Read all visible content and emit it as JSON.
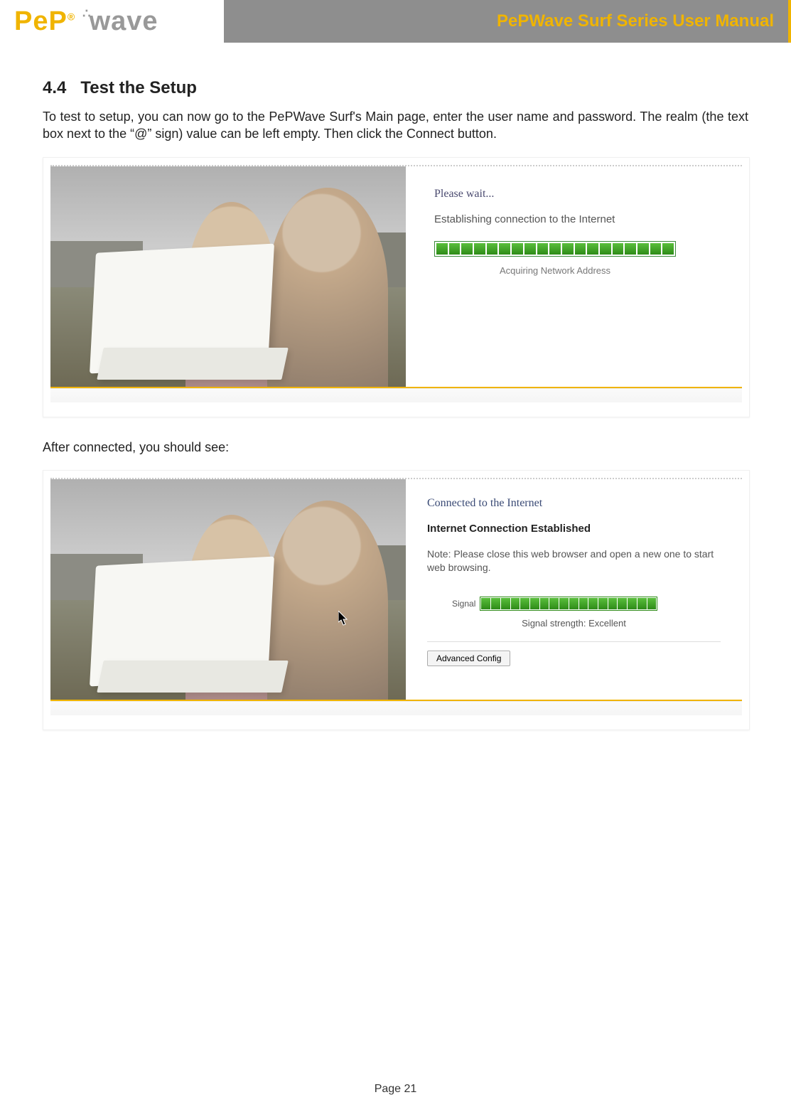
{
  "header": {
    "logo_left": "PeP",
    "logo_right": "wave",
    "title": "PePWave Surf Series User Manual"
  },
  "section": {
    "number": "4.4",
    "title": "Test the Setup",
    "intro": "To test to setup, you can now go to the PePWave Surf's Main page, enter the user name and password.  The realm (the text box next to the “@” sign) value can be left empty.  Then click the Connect button.",
    "after": "After connected, you should see:"
  },
  "screenshot1": {
    "wait": "Please wait...",
    "establishing": "Establishing connection to the Internet",
    "acquiring": "Acquiring Network Address",
    "progress_segments_total": 19,
    "progress_segments_filled": 19
  },
  "screenshot2": {
    "connected": "Connected to the Internet",
    "established": "Internet Connection Established",
    "note": "Note: Please close this web browser and open a new one to start web browsing.",
    "signal_label": "Signal",
    "signal_segments": 18,
    "strength": "Signal strength: Excellent",
    "advanced_button": "Advanced Config"
  },
  "footer": {
    "page": "Page 21"
  }
}
